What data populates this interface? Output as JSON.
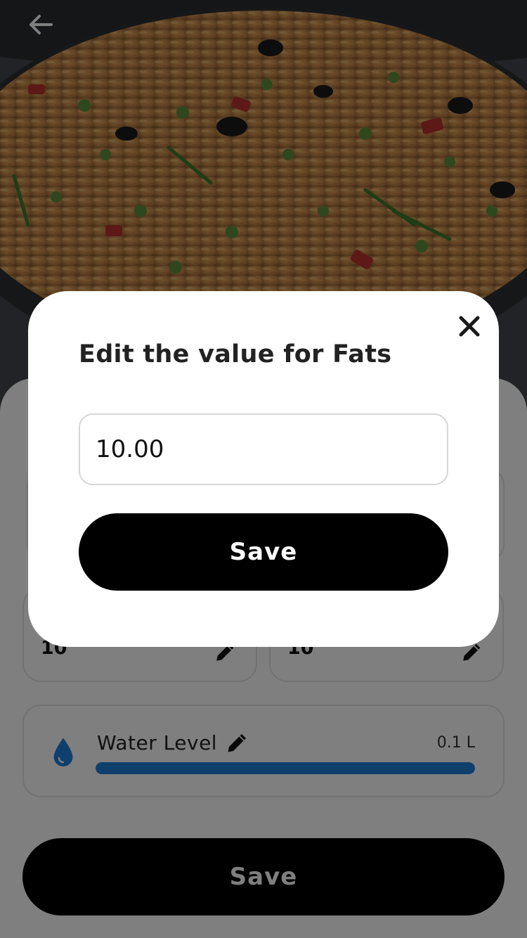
{
  "header": {
    "back_icon": "arrow-left-icon"
  },
  "macros": [
    {
      "value": "10",
      "edit_icon": "pencil-icon"
    },
    {
      "value": "10",
      "edit_icon": "pencil-icon"
    }
  ],
  "water": {
    "icon": "water-drop-icon",
    "title": "Water Level",
    "edit_icon": "pencil-icon",
    "value": "0.1 L",
    "progress_fraction": 1.0,
    "color": "#1e7fd8"
  },
  "bottom_save_label": "Save",
  "modal": {
    "title": "Edit the value for Fats",
    "close_icon": "close-icon",
    "input_value": "10.00",
    "save_label": "Save"
  }
}
